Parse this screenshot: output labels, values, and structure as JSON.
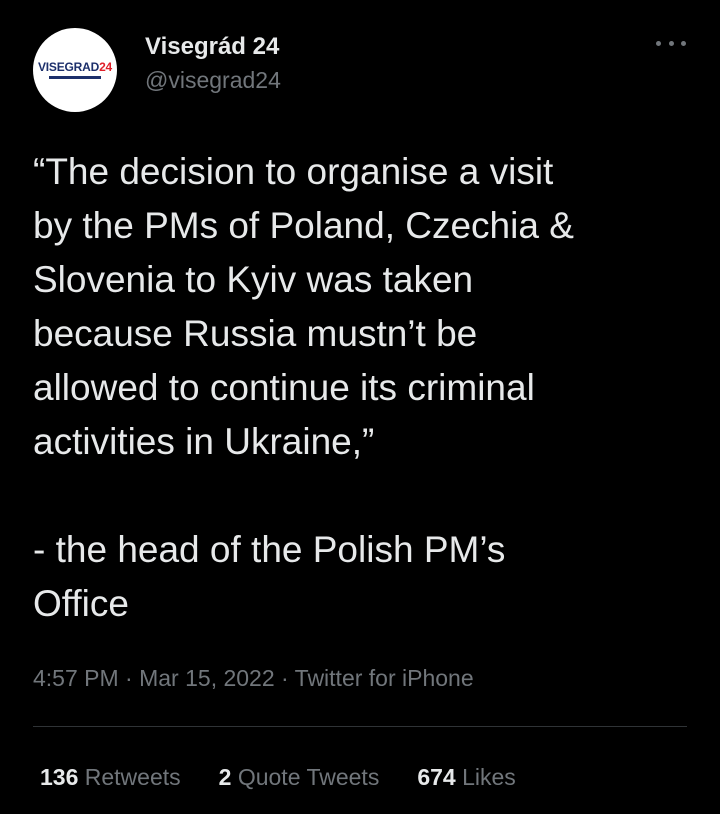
{
  "author": {
    "display_name": "Visegrád 24",
    "handle": "@visegrad24",
    "avatar_text_main": "VISEGRAD",
    "avatar_text_num": "24"
  },
  "tweet": {
    "text": "“The decision to organise a visit\nby the PMs of Poland, Czechia &\nSlovenia to Kyiv was taken\nbecause Russia mustn’t be\nallowed to continue its criminal\nactivities in Ukraine,”\n\n- the head of the Polish PM’s\nOffice"
  },
  "meta": {
    "time": "4:57 PM",
    "sep1": " · ",
    "date": "Mar 15, 2022",
    "sep2": " · ",
    "source": "Twitter for iPhone"
  },
  "stats": {
    "retweets_count": "136",
    "retweets_label": "Retweets",
    "quotes_count": "2",
    "quotes_label": "Quote Tweets",
    "likes_count": "674",
    "likes_label": "Likes"
  },
  "icons": {
    "more": "more-horizontal-icon"
  }
}
